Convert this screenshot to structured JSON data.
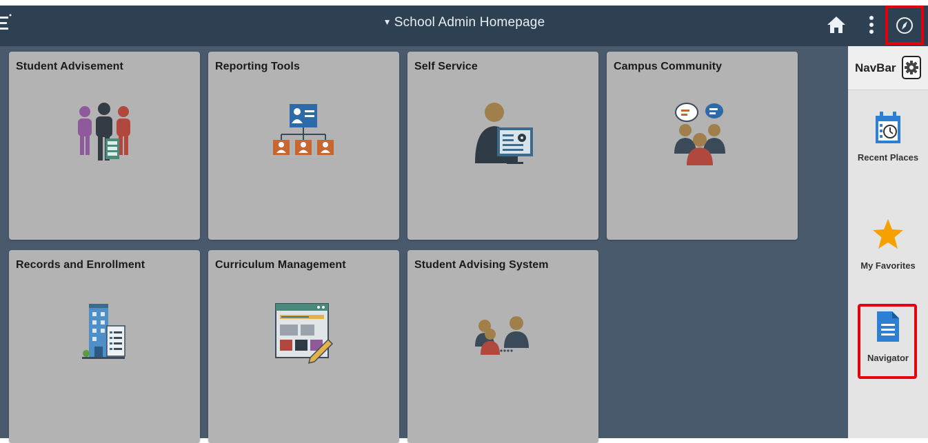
{
  "header": {
    "title": "School Admin Homepage",
    "caret": "▼",
    "icons": [
      "logo-icon",
      "home-icon",
      "more-options-icon",
      "navbar-compass-icon"
    ]
  },
  "tiles": [
    {
      "title": "Student Advisement",
      "icon": "people-group-icon"
    },
    {
      "title": "Reporting Tools",
      "icon": "org-chart-icon"
    },
    {
      "title": "Self Service",
      "icon": "person-monitor-icon"
    },
    {
      "title": "Campus Community",
      "icon": "chat-people-icon"
    },
    {
      "title": "Records and Enrollment",
      "icon": "building-document-icon"
    },
    {
      "title": "Curriculum Management",
      "icon": "browser-pencil-icon"
    },
    {
      "title": "Student Advising System",
      "icon": "people-connect-icon"
    }
  ],
  "navbar": {
    "title": "NavBar",
    "items": [
      {
        "label": "Recent Places",
        "icon": "calendar-clock-icon"
      },
      {
        "label": "My Favorites",
        "icon": "star-icon"
      },
      {
        "label": "Navigator",
        "icon": "document-icon"
      }
    ]
  },
  "colors": {
    "header": "#2e4152",
    "main": "#485a6b",
    "tile": "#b3b3b3",
    "highlight": "#e4000e",
    "star": "#f5a100",
    "doc": "#2d7fd3"
  }
}
